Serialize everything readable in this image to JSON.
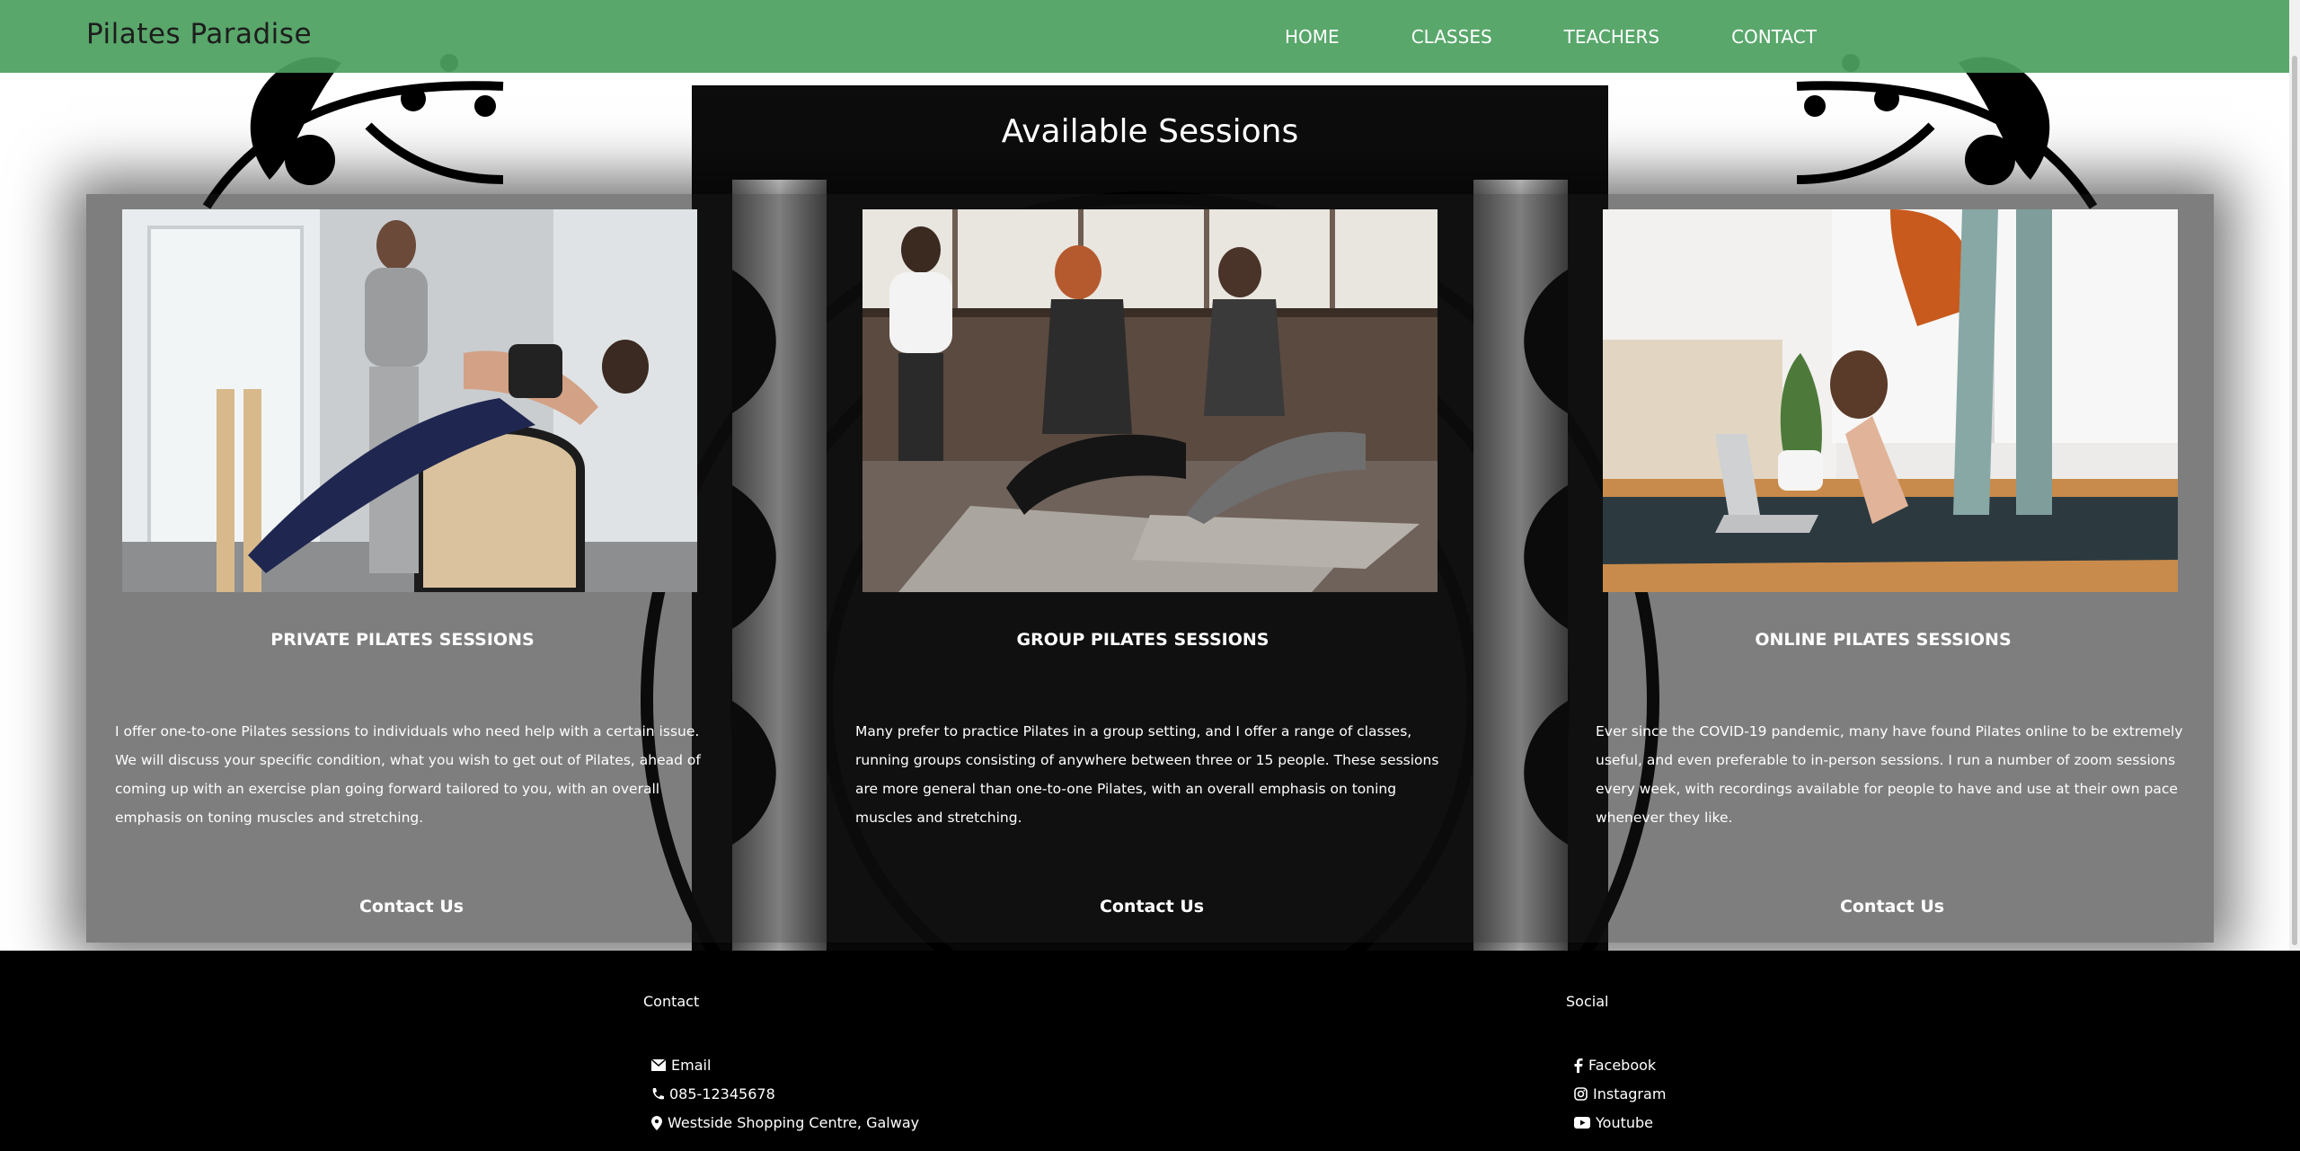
{
  "brand": "Pilates Paradise",
  "nav": [
    "HOME",
    "CLASSES",
    "TEACHERS",
    "CONTACT"
  ],
  "section_title": "Available Sessions",
  "cards": [
    {
      "title": "PRIVATE PILATES SESSIONS",
      "text": "I offer one-to-one Pilates sessions to individuals who need help with a certain issue. We will discuss your specific condition, what you wish to get out of Pilates, ahead of coming up with an exercise plan going forward tailored to you, with an overall emphasis on toning muscles and stretching.",
      "contact": "Contact Us",
      "image": "private-session-photo"
    },
    {
      "title": "GROUP PILATES SESSIONS",
      "text": "Many prefer to practice Pilates in a group setting, and I offer a range of classes, running groups consisting of anywhere between three or 15 people. These sessions are more general than one-to-one Pilates, with an overall emphasis on toning muscles and stretching.",
      "contact": "Contact Us",
      "image": "group-session-photo"
    },
    {
      "title": "ONLINE PILATES SESSIONS",
      "text": "Ever since the COVID-19 pandemic, many have found Pilates online to be extremely useful, and even preferable to in-person sessions. I run a number of zoom sessions every week, with recordings available for people to have and use at their own pace whenever they like.",
      "contact": "Contact Us",
      "image": "online-session-photo"
    }
  ],
  "footer": {
    "contact_heading": "Contact",
    "contact_items": [
      {
        "icon": "envelope-icon",
        "label": "Email"
      },
      {
        "icon": "phone-icon",
        "label": "085-12345678"
      },
      {
        "icon": "map-marker-icon",
        "label": "Westside Shopping Centre, Galway"
      }
    ],
    "social_heading": "Social",
    "social_items": [
      {
        "icon": "facebook-icon",
        "label": "Facebook"
      },
      {
        "icon": "instagram-icon",
        "label": "Instagram"
      },
      {
        "icon": "youtube-icon",
        "label": "Youtube"
      }
    ]
  },
  "colors": {
    "navbar": "#4ca060",
    "footer": "#000000",
    "panel": "#141414"
  }
}
